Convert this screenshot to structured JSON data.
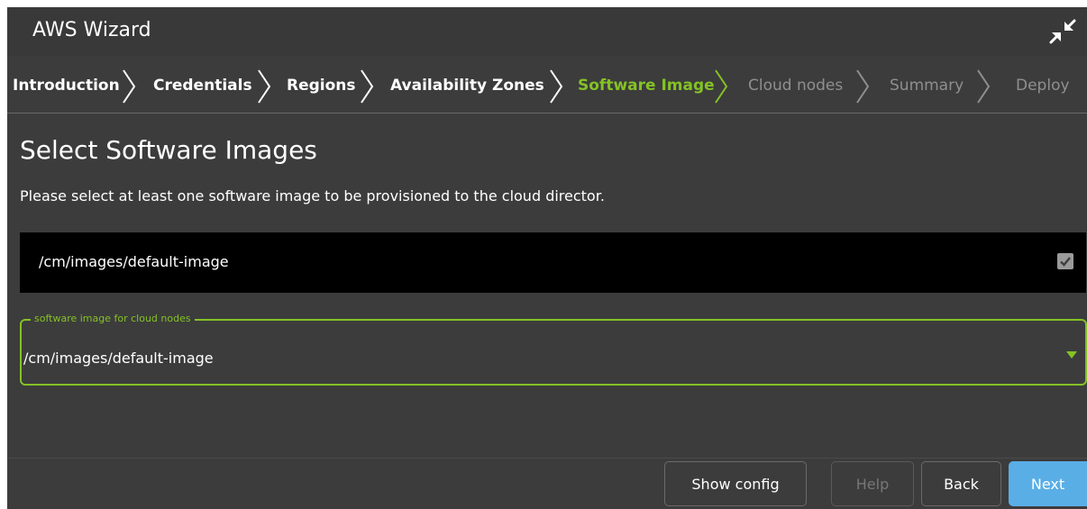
{
  "window": {
    "title": "AWS Wizard"
  },
  "steps": [
    {
      "label": "Introduction",
      "state": "done"
    },
    {
      "label": "Credentials",
      "state": "done"
    },
    {
      "label": "Regions",
      "state": "done"
    },
    {
      "label": "Availability Zones",
      "state": "done"
    },
    {
      "label": "Software Image",
      "state": "active"
    },
    {
      "label": "Cloud nodes",
      "state": "disabled"
    },
    {
      "label": "Summary",
      "state": "disabled"
    },
    {
      "label": "Deploy",
      "state": "disabled"
    }
  ],
  "content": {
    "heading": "Select Software Images",
    "description": "Please select at least one software image to be provisioned to the cloud director.",
    "images": [
      {
        "path": "/cm/images/default-image",
        "checked": true
      }
    ],
    "cloud_node_image": {
      "label": "software image for cloud nodes",
      "value": "/cm/images/default-image"
    }
  },
  "footer": {
    "show_config_label": "Show config",
    "help_label": "Help",
    "back_label": "Back",
    "next_label": "Next"
  },
  "colors": {
    "accent": "#84c225",
    "primary_button": "#5aaee6",
    "background": "#3c3c3c"
  },
  "icons": {
    "collapse": "collapse-arrows-icon",
    "step_separator": "chevron-right-icon",
    "checkbox": "checkmark-icon",
    "dropdown": "caret-down-icon"
  }
}
